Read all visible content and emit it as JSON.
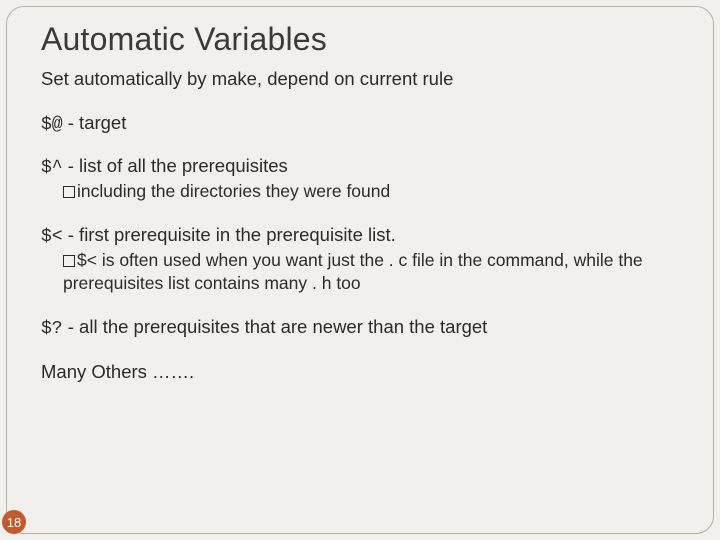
{
  "slide": {
    "title": "Automatic Variables",
    "subtitle": "Set automatically by make, depend on current rule",
    "vars": [
      {
        "sym": "$@",
        "desc": " - target",
        "subs": []
      },
      {
        "sym": "$^",
        "desc": " - list of all the prerequisites",
        "subs": [
          "including the directories they were found"
        ]
      },
      {
        "sym": "$<",
        "desc": "  - first prerequisite in the prerequisite list.",
        "subs": [
          "$< is often used when you want just the . c file in the command, while the prerequisites list contains many . h too"
        ]
      },
      {
        "sym": "$?",
        "desc": "  - all the prerequisites that are newer than the target",
        "subs": []
      }
    ],
    "many": "Many Others …….",
    "page": "18"
  }
}
